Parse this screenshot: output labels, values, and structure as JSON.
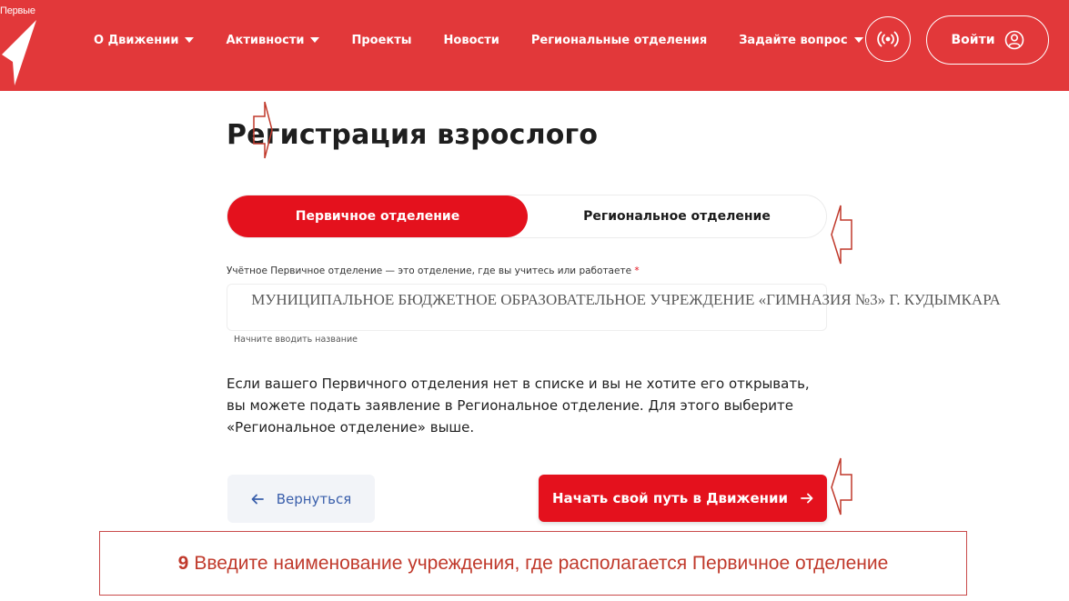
{
  "header": {
    "logo_text": "Первые",
    "nav": [
      {
        "label": "О Движении",
        "has_caret": true
      },
      {
        "label": "Активности",
        "has_caret": true
      },
      {
        "label": "Проекты",
        "has_caret": false
      },
      {
        "label": "Новости",
        "has_caret": false
      },
      {
        "label": "Региональные отделения",
        "has_caret": false
      },
      {
        "label": "Задайте вопрос",
        "has_caret": true
      }
    ],
    "login_label": "Войти",
    "icons": {
      "broadcast": "broadcast-icon",
      "user": "user-icon"
    }
  },
  "page": {
    "title": "Регистрация взрослого"
  },
  "tabs": {
    "primary": "Первичное отделение",
    "regional": "Региональное отделение"
  },
  "form": {
    "label": "Учётное Первичное отделение — это отделение, где вы учитесь или работаете",
    "required_mark": "*",
    "value": "МУНИЦИПАЛЬНОЕ БЮДЖЕТНОЕ ОБРАЗОВАТЕЛЬНОЕ УЧРЕЖДЕНИЕ «ГИМНАЗИЯ №3» Г. КУДЫМКАРА",
    "hint": "Начните вводить название"
  },
  "info": {
    "text": "Если вашего Первичного отделения нет в списке и вы не хотите его открывать, вы можете подать заявление в Региональное отделение. Для этого выберите «Региональное отделение» выше."
  },
  "buttons": {
    "back": "Вернуться",
    "start": "Начать свой путь в Движении"
  },
  "instruction": {
    "number": "9",
    "text": "Введите наименование учреждения, где располагается Первичное отделение"
  },
  "colors": {
    "header_bg": "#e2383a",
    "accent": "#e4111d",
    "back_text": "#3a5fab",
    "instruction_text": "#c0392b"
  }
}
